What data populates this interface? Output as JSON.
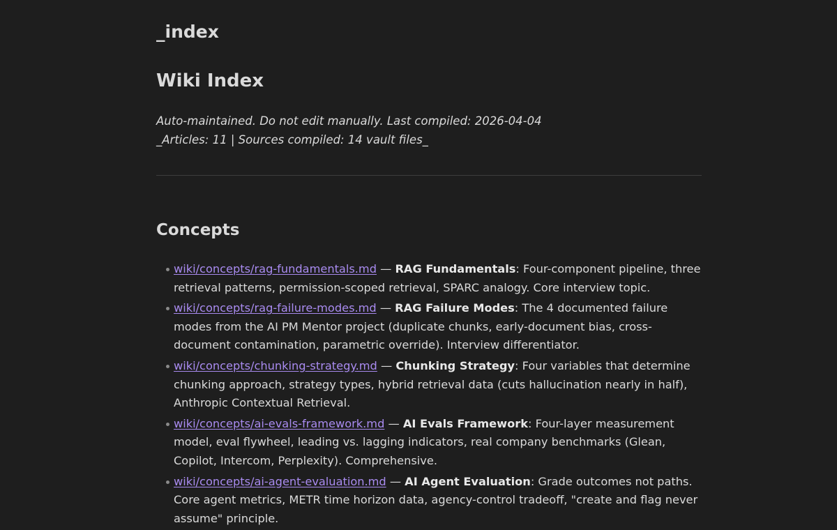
{
  "file_title": "_index",
  "heading": "Wiki Index",
  "meta": {
    "line1": "Auto-maintained. Do not edit manually. Last compiled: 2026-04-04",
    "line2": "_Articles: 11 | Sources compiled: 14 vault files_"
  },
  "section": {
    "title": "Concepts"
  },
  "separator": " — ",
  "items": [
    {
      "link": "wiki/concepts/rag-fundamentals.md",
      "title": "RAG Fundamentals",
      "desc": ": Four-component pipeline, three retrieval patterns, permission-scoped retrieval, SPARC analogy. Core interview topic."
    },
    {
      "link": "wiki/concepts/rag-failure-modes.md",
      "title": "RAG Failure Modes",
      "desc": ": The 4 documented failure modes from the AI PM Mentor project (duplicate chunks, early-document bias, cross-document contamination, parametric override). Interview differentiator."
    },
    {
      "link": "wiki/concepts/chunking-strategy.md",
      "title": "Chunking Strategy",
      "desc": ": Four variables that determine chunking approach, strategy types, hybrid retrieval data (cuts hallucination nearly in half), Anthropic Contextual Retrieval."
    },
    {
      "link": "wiki/concepts/ai-evals-framework.md",
      "title": "AI Evals Framework",
      "desc": ": Four-layer measurement model, eval flywheel, leading vs. lagging indicators, real company benchmarks (Glean, Copilot, Intercom, Perplexity). Comprehensive."
    },
    {
      "link": "wiki/concepts/ai-agent-evaluation.md",
      "title": "AI Agent Evaluation",
      "desc": ": Grade outcomes not paths. Core agent metrics, METR time horizon data, agency-control tradeoff, \"create and flag never assume\" principle."
    }
  ]
}
